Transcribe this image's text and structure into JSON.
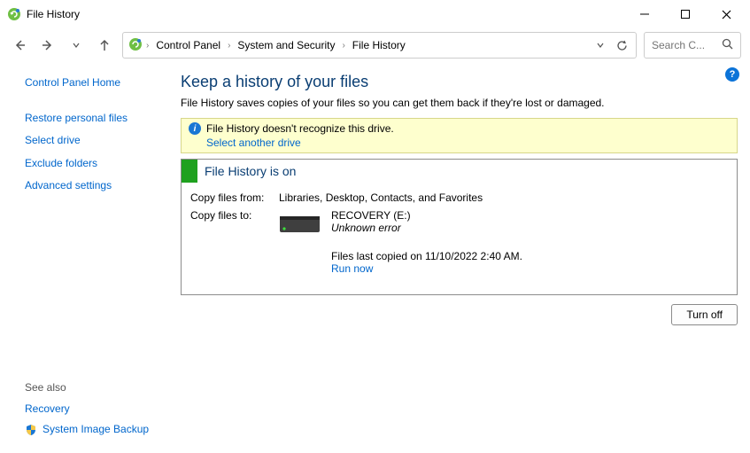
{
  "window": {
    "title": "File History"
  },
  "breadcrumbs": {
    "b0": "Control Panel",
    "b1": "System and Security",
    "b2": "File History"
  },
  "search": {
    "placeholder": "Search C..."
  },
  "sidebar": {
    "home": "Control Panel Home",
    "i0": "Restore personal files",
    "i1": "Select drive",
    "i2": "Exclude folders",
    "i3": "Advanced settings"
  },
  "see_also": {
    "header": "See also",
    "i0": "Recovery",
    "i1": "System Image Backup"
  },
  "page": {
    "title": "Keep a history of your files",
    "desc": "File History saves copies of your files so you can get them back if they're lost or damaged."
  },
  "warning": {
    "text": "File History doesn't recognize this drive.",
    "link": "Select another drive"
  },
  "status": {
    "title": "File History is on",
    "copy_from_label": "Copy files from:",
    "copy_from_value": "Libraries, Desktop, Contacts, and Favorites",
    "copy_to_label": "Copy files to:",
    "drive_name": "RECOVERY (E:)",
    "drive_error": "Unknown error",
    "last_copied": "Files last copied on 11/10/2022 2:40 AM.",
    "run_now": "Run now"
  },
  "buttons": {
    "turn_off": "Turn off"
  }
}
